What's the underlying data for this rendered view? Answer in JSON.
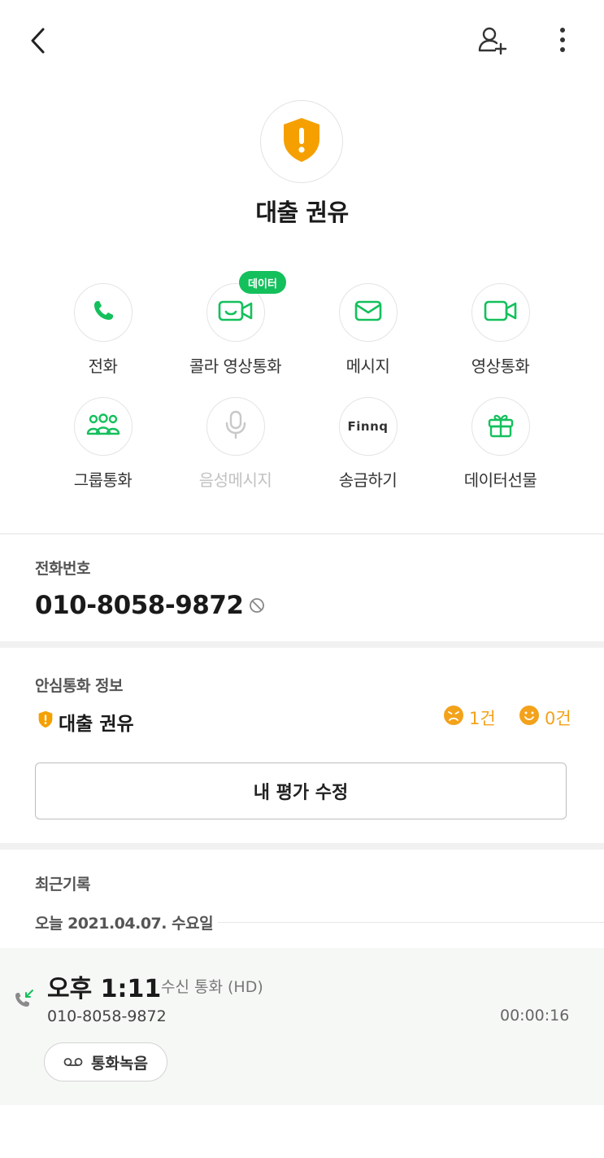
{
  "header": {
    "back_icon": "chevron-left-icon",
    "add_icon": "add-contact-icon",
    "more_icon": "more-vertical-icon"
  },
  "contact": {
    "name": "대출 권유",
    "avatar_icon": "warning-shield-icon"
  },
  "actions": [
    {
      "label": "전화",
      "icon": "phone-icon",
      "disabled": false
    },
    {
      "label": "콜라 영상통화",
      "icon": "video-chat-icon",
      "badge": "데이터",
      "disabled": false
    },
    {
      "label": "메시지",
      "icon": "mail-icon",
      "disabled": false
    },
    {
      "label": "영상통화",
      "icon": "video-camera-icon",
      "disabled": false
    },
    {
      "label": "그룹통화",
      "icon": "group-icon",
      "disabled": false
    },
    {
      "label": "음성메시지",
      "icon": "microphone-icon",
      "disabled": true
    },
    {
      "label": "송금하기",
      "icon": "finnq-logo-icon",
      "logo_text": "Finnq",
      "disabled": false
    },
    {
      "label": "데이터선물",
      "icon": "gift-icon",
      "disabled": false
    }
  ],
  "phone_section": {
    "title": "전화번호",
    "number": "010-8058-9872"
  },
  "safe_call": {
    "title": "안심통화 정보",
    "label": "대출 권유",
    "bad_count": "1건",
    "good_count": "0건",
    "edit_button": "내 평가 수정"
  },
  "recent": {
    "title": "최근기록",
    "date": "오늘 2021.04.07. 수요일",
    "log": {
      "time": "오후 1:11",
      "type": "수신 통화 (HD)",
      "number": "010-8058-9872",
      "duration": "00:00:16",
      "record_button": "통화녹음"
    }
  },
  "colors": {
    "accent_green": "#14c05c",
    "warning_orange": "#f5a000",
    "rating_orange": "#f3a21b"
  }
}
